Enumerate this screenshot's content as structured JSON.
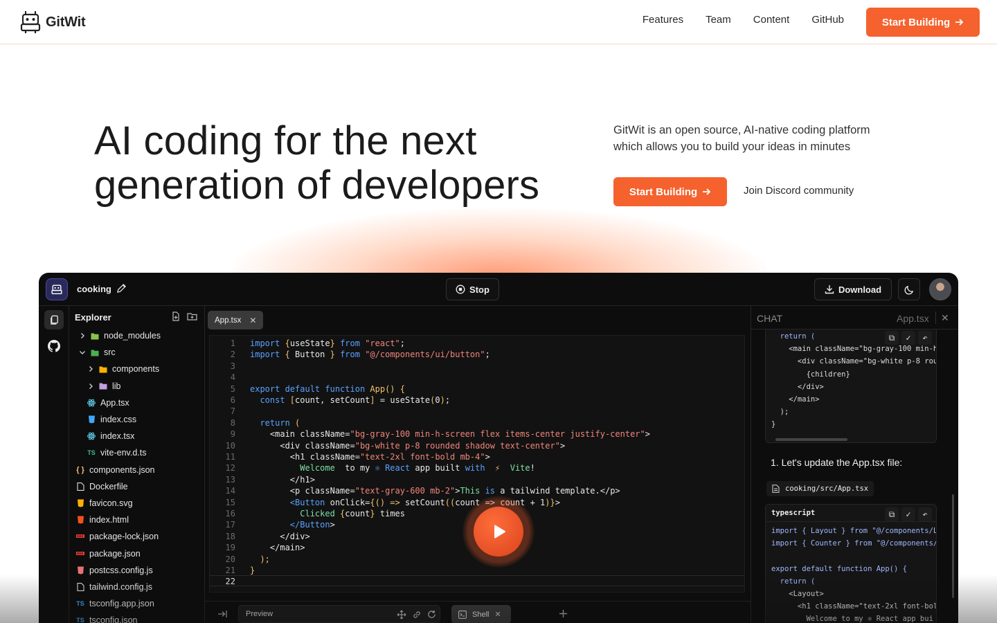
{
  "nav": {
    "brand": "GitWit",
    "links": [
      "Features",
      "Team",
      "Content",
      "GitHub"
    ],
    "cta": "Start Building"
  },
  "hero": {
    "title_line1": "AI coding for the next",
    "title_line2": "generation of developers",
    "desc_line1": "GitWit is an open source, AI-native coding platform",
    "desc_line2": "which allows you to build your ideas in minutes",
    "cta": "Start Building",
    "discord": "Join Discord community"
  },
  "app": {
    "project": "cooking",
    "stop": "Stop",
    "download": "Download",
    "explorer": {
      "title": "Explorer",
      "items": [
        {
          "label": "node_modules",
          "type": "folder",
          "depth": 0,
          "chev": ">",
          "icon": "node-folder-icon",
          "color": "#8bc34a"
        },
        {
          "label": "src",
          "type": "folder",
          "depth": 0,
          "chev": "v",
          "icon": "src-folder-icon",
          "color": "#4caf50"
        },
        {
          "label": "components",
          "type": "folder",
          "depth": 1,
          "chev": ">",
          "icon": "components-folder-icon",
          "color": "#ffb300"
        },
        {
          "label": "lib",
          "type": "folder",
          "depth": 1,
          "chev": ">",
          "icon": "lib-folder-icon",
          "color": "#c0a0e0"
        },
        {
          "label": "App.tsx",
          "type": "file",
          "depth": 1,
          "icon": "react-icon",
          "color": "#61dafb"
        },
        {
          "label": "index.css",
          "type": "file",
          "depth": 1,
          "icon": "css-icon",
          "color": "#42a5f5"
        },
        {
          "label": "index.tsx",
          "type": "file",
          "depth": 1,
          "icon": "react-icon",
          "color": "#61dafb"
        },
        {
          "label": "vite-env.d.ts",
          "type": "file",
          "depth": 1,
          "icon": "typescript-icon",
          "color": "#3fbf8f"
        },
        {
          "label": "components.json",
          "type": "file",
          "depth": 0,
          "icon": "json-icon",
          "color": "#f5c26b"
        },
        {
          "label": "Dockerfile",
          "type": "file",
          "depth": 0,
          "icon": "file-icon",
          "color": "#dddddd"
        },
        {
          "label": "favicon.svg",
          "type": "file",
          "depth": 0,
          "icon": "svg-icon",
          "color": "#ffb300"
        },
        {
          "label": "index.html",
          "type": "file",
          "depth": 0,
          "icon": "html-icon",
          "color": "#f4511e"
        },
        {
          "label": "package-lock.json",
          "type": "file",
          "depth": 0,
          "icon": "npm-icon",
          "color": "#e53935"
        },
        {
          "label": "package.json",
          "type": "file",
          "depth": 0,
          "icon": "npm-icon",
          "color": "#e53935"
        },
        {
          "label": "postcss.config.js",
          "type": "file",
          "depth": 0,
          "icon": "postcss-icon",
          "color": "#e57373"
        },
        {
          "label": "tailwind.config.js",
          "type": "file",
          "depth": 0,
          "icon": "file-icon",
          "color": "#dddddd"
        },
        {
          "label": "tsconfig.app.json",
          "type": "file",
          "depth": 0,
          "icon": "tsconfig-icon",
          "color": "#42a5f5"
        },
        {
          "label": "tsconfig.json",
          "type": "file",
          "depth": 0,
          "icon": "tsconfig-icon",
          "color": "#42a5f5"
        }
      ]
    },
    "tab": "App.tsx",
    "code": [
      [
        [
          "kw",
          "import "
        ],
        [
          "pu",
          "{"
        ],
        [
          "",
          "useState"
        ],
        [
          "pu",
          "}"
        ],
        [
          "kw",
          " from "
        ],
        [
          "st",
          "\"react\""
        ],
        [
          "",
          ";"
        ]
      ],
      [
        [
          "kw",
          "import "
        ],
        [
          "pu",
          "{"
        ],
        [
          "",
          " Button "
        ],
        [
          "pu",
          "}"
        ],
        [
          "kw",
          " from "
        ],
        [
          "st",
          "\"@/components/ui/button\""
        ],
        [
          "",
          ";"
        ]
      ],
      [],
      [],
      [
        [
          "kw",
          "export default function "
        ],
        [
          "fn",
          "App"
        ],
        [
          "pu",
          "() {"
        ]
      ],
      [
        [
          "kw",
          "  const "
        ],
        [
          "pu",
          "["
        ],
        [
          "",
          "count, setCount"
        ],
        [
          "pu",
          "]"
        ],
        [
          "",
          " = useState"
        ],
        [
          "pu",
          "("
        ],
        [
          "",
          "0"
        ],
        [
          "pu",
          ")"
        ],
        [
          "",
          ";"
        ]
      ],
      [],
      [
        [
          "kw",
          "  return "
        ],
        [
          "pu",
          "("
        ]
      ],
      [
        [
          "",
          "    <main className="
        ],
        [
          "st",
          "\"bg-gray-100 min-h-screen flex items-center justify-center\""
        ],
        [
          "",
          ">"
        ]
      ],
      [
        [
          "",
          "      <div className="
        ],
        [
          "st",
          "\"bg-white p-8 rounded shadow text-center\""
        ],
        [
          "",
          ">"
        ]
      ],
      [
        [
          "",
          "        <h1 className="
        ],
        [
          "st",
          "\"text-2xl font-bold mb-4\""
        ],
        [
          "",
          ">"
        ]
      ],
      [
        [
          "jsx",
          "          Welcome "
        ],
        [
          "",
          " to my "
        ],
        [
          "kw",
          "⚛ React"
        ],
        [
          "",
          " app built "
        ],
        [
          "kw",
          "with"
        ],
        [
          "pu",
          "  ⚡ "
        ],
        [
          "jsx",
          " Vite"
        ],
        [
          "",
          "!"
        ]
      ],
      [
        [
          "",
          "        </h1>"
        ]
      ],
      [
        [
          "",
          "        <p className="
        ],
        [
          "st",
          "\"text-gray-600 mb-2\""
        ],
        [
          "",
          ">"
        ],
        [
          "jsx",
          "This "
        ],
        [
          "kw",
          "is"
        ],
        [
          "",
          " a tailwind template.</p>"
        ]
      ],
      [
        [
          "kw",
          "        <Button "
        ],
        [
          "",
          "onClick="
        ],
        [
          "pu",
          "{() => "
        ],
        [
          "",
          "setCount"
        ],
        [
          "pu",
          "(("
        ],
        [
          "",
          "count"
        ],
        [
          "",
          " => count + 1"
        ],
        [
          "pu",
          ")}"
        ],
        [
          "",
          ">"
        ]
      ],
      [
        [
          "jsx",
          "          Clicked "
        ],
        [
          "pu",
          "{"
        ],
        [
          "",
          "count"
        ],
        [
          "pu",
          "}"
        ],
        [
          "",
          " times"
        ]
      ],
      [
        [
          "kw",
          "        </Button"
        ],
        [
          "",
          ">"
        ]
      ],
      [
        [
          "",
          "      </div>"
        ]
      ],
      [
        [
          "",
          "    </main>"
        ]
      ],
      [
        [
          "pu",
          "  );"
        ]
      ],
      [
        [
          "pu",
          "}"
        ]
      ],
      []
    ],
    "bottom": {
      "preview": "Preview",
      "shell": "Shell"
    },
    "chat": {
      "title": "CHAT",
      "file": "App.tsx",
      "block1": [
        "  return (",
        "    <main className=\"bg-gray-100 min-h",
        "      <div className=\"bg-white p-8 roun",
        "        {children}",
        "      </div>",
        "    </main>",
        "  );",
        "}"
      ],
      "message": "1. Let's update the App.tsx file:",
      "file_chip": "cooking/src/App.tsx",
      "block2_lang": "typescript",
      "block2": [
        "import { Layout } from \"@/components/La",
        "import { Counter } from \"@/components/",
        "",
        "export default function App() {",
        "  return (",
        "    <Layout>",
        "      <h1 className=\"text-2xl font-bol",
        "        Welcome to my ⚛ React app bui"
      ]
    }
  }
}
